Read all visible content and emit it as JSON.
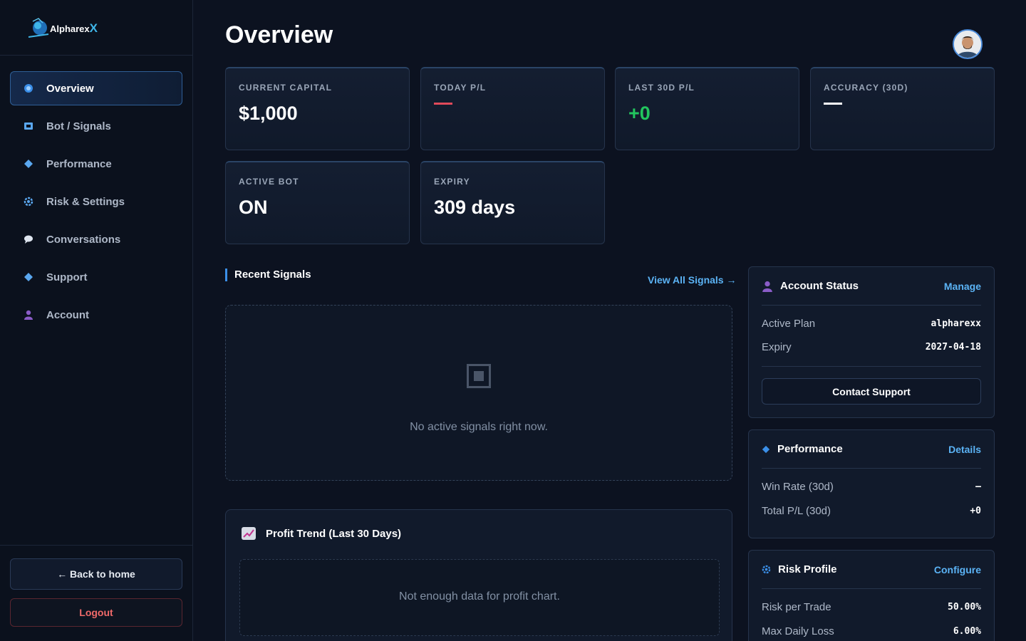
{
  "sidebar": {
    "logo_text": "Alpharex",
    "logo_accent": "X",
    "items": [
      {
        "label": "Overview",
        "icon": "target-icon"
      },
      {
        "label": "Bot / Signals",
        "icon": "bot-icon"
      },
      {
        "label": "Performance",
        "icon": "diamond-icon"
      },
      {
        "label": "Risk & Settings",
        "icon": "gear-icon"
      },
      {
        "label": "Conversations",
        "icon": "chat-icon"
      },
      {
        "label": "Support",
        "icon": "diamond-icon"
      },
      {
        "label": "Account",
        "icon": "user-icon"
      }
    ],
    "back_home": "← Back to home",
    "logout": "Logout"
  },
  "header": {
    "title": "Overview"
  },
  "stats": [
    {
      "label": "CURRENT CAPITAL",
      "value": "$1,000"
    },
    {
      "label": "TODAY P/L",
      "value": ""
    },
    {
      "label": "LAST 30D P/L",
      "value": "+0"
    },
    {
      "label": "ACCURACY (30D)",
      "value": ""
    },
    {
      "label": "ACTIVE BOT",
      "value": "ON"
    },
    {
      "label": "EXPIRY",
      "value": "309 days"
    }
  ],
  "signals": {
    "title": "Recent Signals",
    "view_all": "View All Signals →",
    "empty": "No active signals right now."
  },
  "profit": {
    "title": "Profit Trend (Last 30 Days)",
    "empty": "Not enough data for profit chart."
  },
  "account_status": {
    "title": "Account Status",
    "link": "Manage",
    "rows": [
      {
        "label": "Active Plan",
        "value": "alpharexx"
      },
      {
        "label": "Expiry",
        "value": "2027-04-18"
      }
    ],
    "button": "Contact Support"
  },
  "performance": {
    "title": "Performance",
    "link": "Details",
    "rows": [
      {
        "label": "Win Rate (30d)",
        "value": "—"
      },
      {
        "label": "Total P/L (30d)",
        "value": "+0"
      }
    ]
  },
  "risk": {
    "title": "Risk Profile",
    "link": "Configure",
    "rows": [
      {
        "label": "Risk per Trade",
        "value": "50.00%"
      },
      {
        "label": "Max Daily Loss",
        "value": "6.00%"
      }
    ]
  },
  "colors": {
    "accent": "#3b8fe8",
    "link": "#5bb3f5",
    "positive": "#22c55e",
    "negative": "#e04a5a",
    "logout": "#f06a6a"
  }
}
